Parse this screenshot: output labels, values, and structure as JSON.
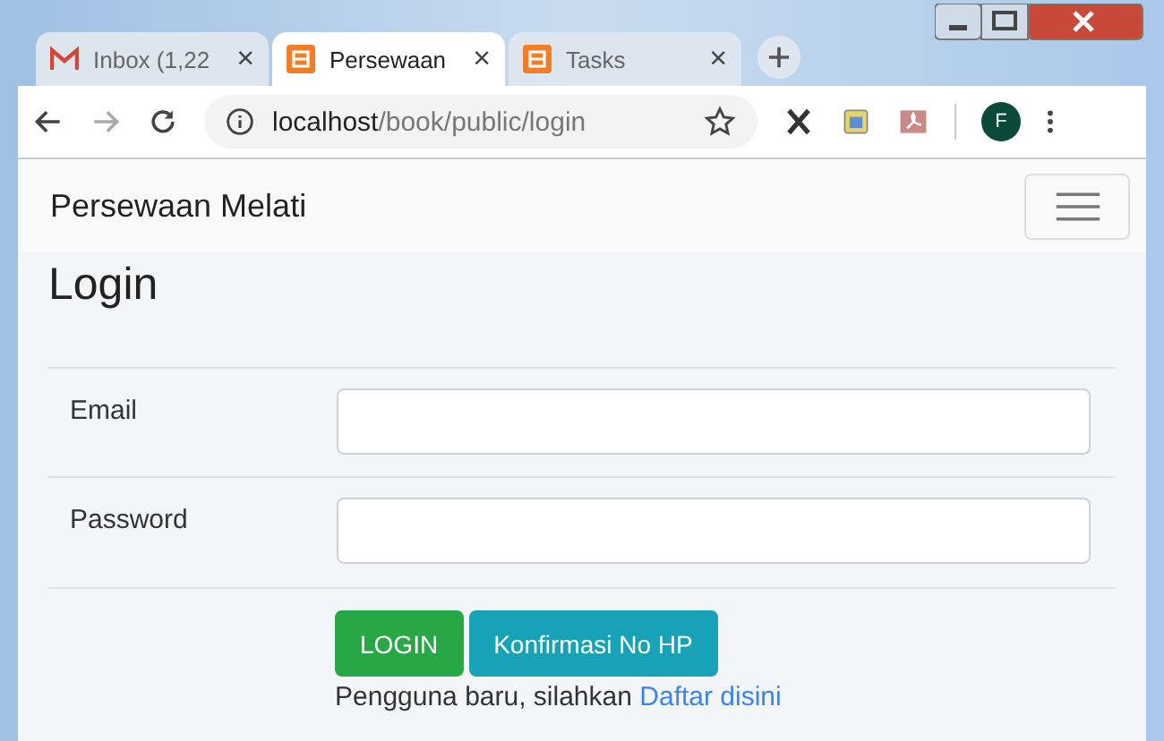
{
  "browser": {
    "tabs": [
      {
        "kind": "gmail",
        "title": "Inbox (1,22",
        "selected": false
      },
      {
        "kind": "xampp",
        "title": "Persewaan",
        "selected": true
      },
      {
        "kind": "xampp",
        "title": "Tasks",
        "selected": false
      }
    ],
    "tab_close": "×",
    "address": {
      "host": "localhost",
      "path": "/book/public/login"
    },
    "profile": "F"
  },
  "navbar": {
    "brand": "Persewaan Melati"
  },
  "heading": "Login",
  "fields": [
    {
      "label": "Email"
    },
    {
      "label": "Password"
    }
  ],
  "buttons": [
    {
      "label": "LOGIN",
      "kind": "success"
    },
    {
      "label": "Konfirmasi No HP",
      "kind": "info"
    }
  ],
  "register": {
    "text": "Pengguna baru, silahkan",
    "link": "Daftar disini"
  }
}
